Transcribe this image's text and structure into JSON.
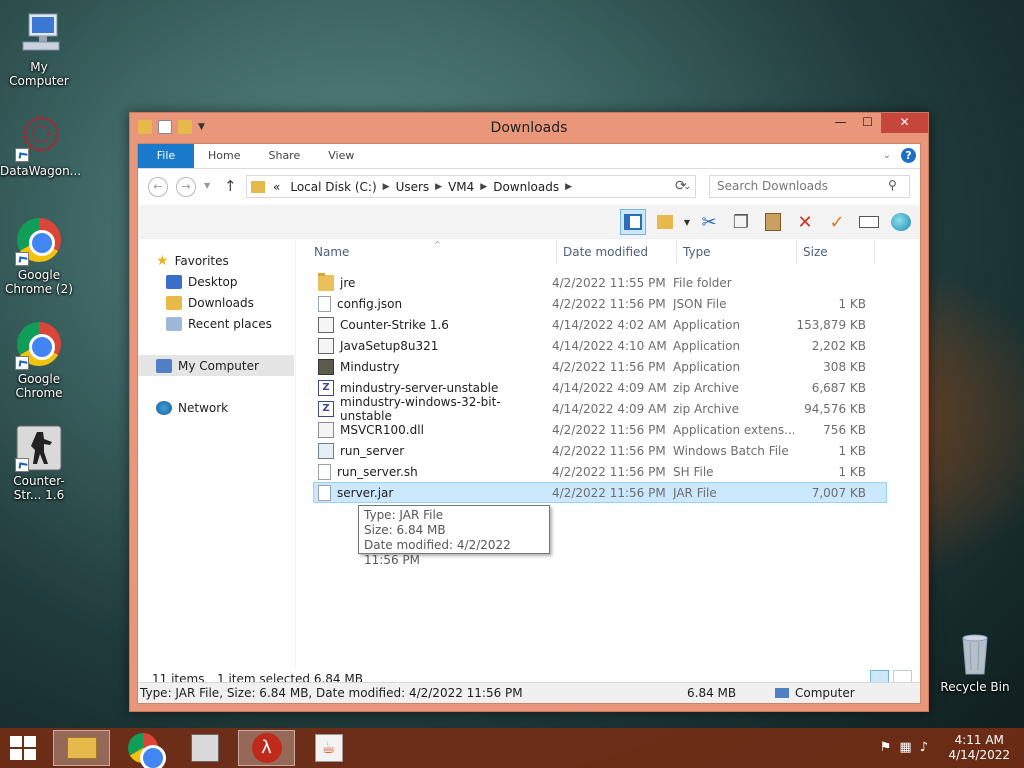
{
  "desktop": {
    "icons": [
      {
        "label": "My Computer"
      },
      {
        "label": "DataWagon..."
      },
      {
        "label": "Google Chrome (2)"
      },
      {
        "label": "Google Chrome"
      },
      {
        "label": "Counter-Str... 1.6"
      },
      {
        "label": "Recycle Bin"
      }
    ]
  },
  "window": {
    "title": "Downloads",
    "controls": {
      "minimize": "—",
      "maximize": "☐",
      "close": "✕"
    },
    "ribbon_tabs": [
      "File",
      "Home",
      "Share",
      "View"
    ],
    "address": {
      "overflow": "«",
      "crumbs": [
        "Local Disk (C:)",
        "Users",
        "VM4",
        "Downloads"
      ]
    },
    "search_placeholder": "Search Downloads",
    "nav_pane": {
      "favorites": "Favorites",
      "desktop": "Desktop",
      "downloads": "Downloads",
      "recent": "Recent places",
      "my_computer": "My Computer",
      "network": "Network"
    },
    "columns": {
      "name": "Name",
      "date": "Date modified",
      "type": "Type",
      "size": "Size"
    },
    "files": [
      {
        "name": "jre",
        "date": "4/2/2022 11:55 PM",
        "type": "File folder",
        "size": "",
        "icon": "folder-icon"
      },
      {
        "name": "config.json",
        "date": "4/2/2022 11:56 PM",
        "type": "JSON File",
        "size": "1 KB",
        "icon": "document-icon"
      },
      {
        "name": "Counter-Strike 1.6",
        "date": "4/14/2022 4:02 AM",
        "type": "Application",
        "size": "153,879 KB",
        "icon": "cs-app-icon"
      },
      {
        "name": "JavaSetup8u321",
        "date": "4/14/2022 4:10 AM",
        "type": "Application",
        "size": "2,202 KB",
        "icon": "java-icon"
      },
      {
        "name": "Mindustry",
        "date": "4/2/2022 11:56 PM",
        "type": "Application",
        "size": "308 KB",
        "icon": "mindustry-icon"
      },
      {
        "name": "mindustry-server-unstable",
        "date": "4/14/2022 4:09 AM",
        "type": "zip Archive",
        "size": "6,687 KB",
        "icon": "zip-icon"
      },
      {
        "name": "mindustry-windows-32-bit-unstable",
        "date": "4/14/2022 4:09 AM",
        "type": "zip Archive",
        "size": "94,576 KB",
        "icon": "zip-icon"
      },
      {
        "name": "MSVCR100.dll",
        "date": "4/2/2022 11:56 PM",
        "type": "Application extens...",
        "size": "756 KB",
        "icon": "dll-icon"
      },
      {
        "name": "run_server",
        "date": "4/2/2022 11:56 PM",
        "type": "Windows Batch File",
        "size": "1 KB",
        "icon": "batch-icon"
      },
      {
        "name": "run_server.sh",
        "date": "4/2/2022 11:56 PM",
        "type": "SH File",
        "size": "1 KB",
        "icon": "document-icon"
      },
      {
        "name": "server.jar",
        "date": "4/2/2022 11:56 PM",
        "type": "JAR File",
        "size": "7,007 KB",
        "icon": "document-icon",
        "selected": true
      }
    ],
    "tooltip": {
      "type": "Type: JAR File",
      "size": "Size: 6.84 MB",
      "date": "Date modified: 4/2/2022 11:56 PM"
    },
    "status": {
      "items": "11 items",
      "selected": "1 item selected  6.84 MB"
    },
    "details_bar": {
      "info": "Type: JAR File, Size: 6.84 MB, Date modified: 4/2/2022 11:56 PM",
      "size": "6.84 MB",
      "location": "Computer"
    }
  },
  "taskbar": {
    "apps": [
      "file-explorer",
      "google-chrome",
      "counter-strike",
      "half-life",
      "java"
    ],
    "clock": {
      "time": "4:11 AM",
      "date": "4/14/2022"
    }
  },
  "colors": {
    "window_frame": "#e9967a",
    "file_tab": "#1979ca",
    "selection": "#cce8ff",
    "close_button": "#c7463b"
  }
}
